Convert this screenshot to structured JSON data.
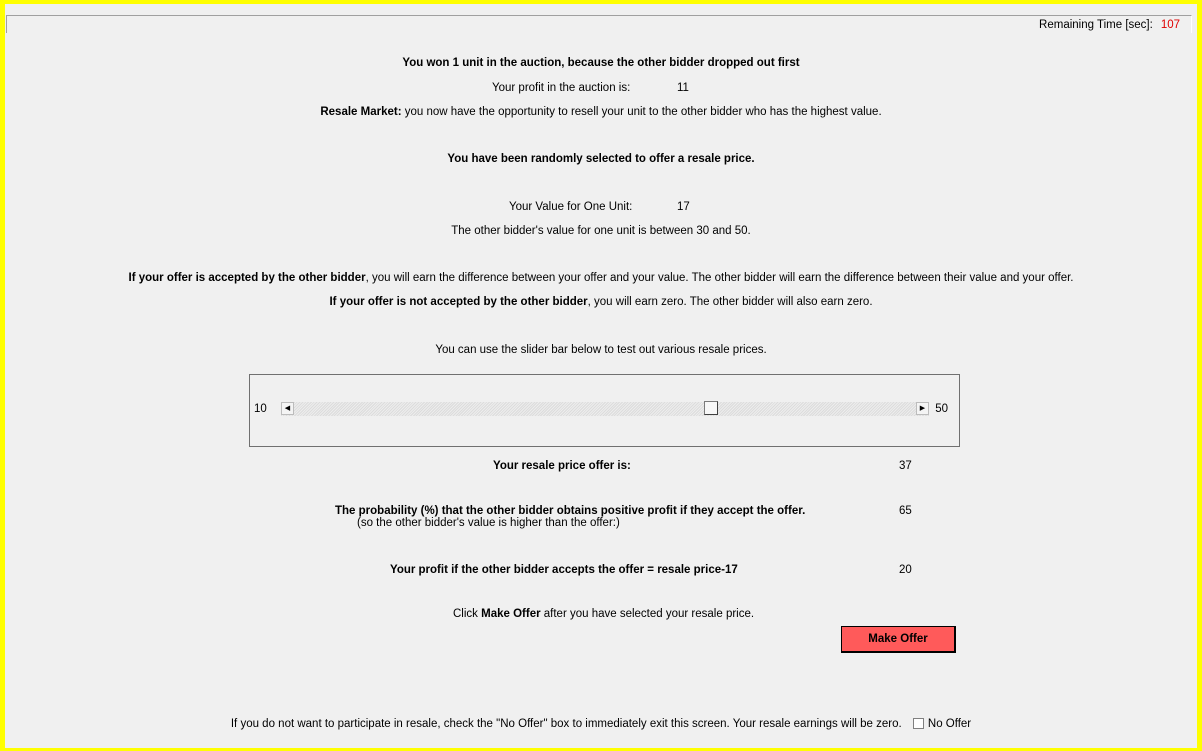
{
  "timer": {
    "label": "Remaining Time [sec]:",
    "value": "107"
  },
  "auction": {
    "won_text": "You won 1 unit in the auction, because the other bidder dropped out first",
    "profit_label": "Your profit in the auction is:",
    "profit_value": "11"
  },
  "resale": {
    "intro_bold": "Resale Market:",
    "intro_rest": " you now have the opportunity to resell your unit to the other bidder who has the highest value.",
    "selected_text": "You have been randomly selected to offer a resale price."
  },
  "values": {
    "own_label": "Your Value for One Unit:",
    "own_value": "17",
    "other_range_text": "The other bidder's value for one unit is between 30 and 50."
  },
  "rules": {
    "accepted_bold": "If your offer is accepted by the other bidder",
    "accepted_rest": ", you will earn the difference between your offer and your value. The other bidder will earn the difference between their value and your offer.",
    "not_accepted_bold": "If your offer is not accepted by the other bidder",
    "not_accepted_rest": ", you will earn zero. The other bidder will also earn zero."
  },
  "slider": {
    "hint": "You can use the slider bar below to test out various resale prices.",
    "min_label": "10",
    "max_label": "50",
    "min": 10,
    "max": 50,
    "value": 37
  },
  "results": {
    "offer_label": "Your resale price offer is:",
    "offer_value": "37",
    "prob_label": "The probability (%) that the other bidder obtains positive profit if they accept the offer.",
    "prob_sub": "(so the other bidder's value is higher than the offer:)",
    "prob_value": "65",
    "profit_label": "Your profit if the other bidder accepts the offer = resale price-17",
    "profit_value": "20"
  },
  "instructions": {
    "click_pre": "Click ",
    "click_bold": "Make Offer",
    "click_post": " after you have selected your resale price."
  },
  "buttons": {
    "make_offer": "Make Offer"
  },
  "no_offer": {
    "text": "If you do not want to participate in resale, check the \"No Offer\" box to immediately exit this screen. Your resale earnings will be zero.",
    "checkbox_label": "No Offer",
    "checked": false
  },
  "colors": {
    "frame": "#ffff00",
    "button": "#ff5a5a",
    "timer_value": "#e00000"
  }
}
